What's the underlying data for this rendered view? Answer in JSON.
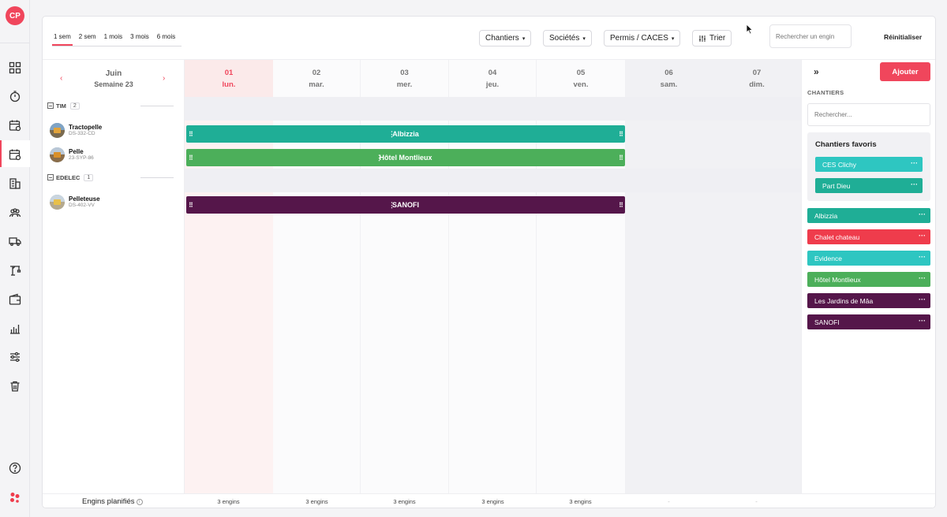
{
  "user": {
    "initials": "CP"
  },
  "toolbar": {
    "ranges": [
      "1 sem",
      "2 sem",
      "1 mois",
      "3 mois",
      "6 mois"
    ],
    "active_range": "1 sem",
    "filters": {
      "chantiers": "Chantiers",
      "societes": "Sociétés",
      "permis": "Permis / CACES",
      "trier": "Trier"
    },
    "search_placeholder": "Rechercher un engin",
    "reset_label": "Réinitialiser"
  },
  "calendar": {
    "month": "Juin",
    "week": "Semaine 23",
    "prev": "‹",
    "next": "›",
    "days": [
      {
        "num": "01",
        "name": "lun."
      },
      {
        "num": "02",
        "name": "mar."
      },
      {
        "num": "03",
        "name": "mer."
      },
      {
        "num": "04",
        "name": "jeu."
      },
      {
        "num": "05",
        "name": "ven."
      },
      {
        "num": "06",
        "name": "sam."
      },
      {
        "num": "07",
        "name": "dim."
      }
    ],
    "today_index": 0
  },
  "groups": [
    {
      "name": "TIM",
      "count": "2",
      "machines": [
        {
          "name": "Tractopelle",
          "code": "DS-332-CD",
          "assignment": "Albizzia",
          "color": "#1fae96"
        },
        {
          "name": "Pelle",
          "code": "23-SYP-86",
          "assignment": "Hôtel Montlieux",
          "color": "#4caf5a"
        }
      ]
    },
    {
      "name": "EDELEC",
      "count": "1",
      "machines": [
        {
          "name": "Pelleteuse",
          "code": "DS-402-VV",
          "assignment": "SANOFI",
          "color": "#55164a"
        }
      ]
    }
  ],
  "footer": {
    "label": "Engins planifiés",
    "info_icon": "i",
    "counts": [
      "3 engins",
      "3 engins",
      "3 engins",
      "3 engins",
      "3 engins",
      "-",
      "-"
    ]
  },
  "right_panel": {
    "collapse_icon": "»",
    "add_label": "Ajouter",
    "section_title": "CHANTIERS",
    "search_placeholder": "Rechercher...",
    "favorites_title": "Chantiers favoris",
    "more_icon": "···",
    "favorites": [
      {
        "name": "CES Clichy",
        "color": "#2ec6c1"
      },
      {
        "name": "Part Dieu",
        "color": "#1fae96"
      }
    ],
    "sites": [
      {
        "name": "Albizzia",
        "color": "#1fae96"
      },
      {
        "name": "Chalet chateau",
        "color": "#ef3c4c"
      },
      {
        "name": "Evidence",
        "color": "#2ec6c1"
      },
      {
        "name": "Hôtel Montlieux",
        "color": "#4caf5a"
      },
      {
        "name": "Les Jardins de Mâa",
        "color": "#55164a"
      },
      {
        "name": "SANOFI",
        "color": "#55164a"
      }
    ]
  },
  "colors": {
    "accent": "#f0465c",
    "weekend": "#f1f1f4",
    "today_tint": "#fdf2f2"
  }
}
